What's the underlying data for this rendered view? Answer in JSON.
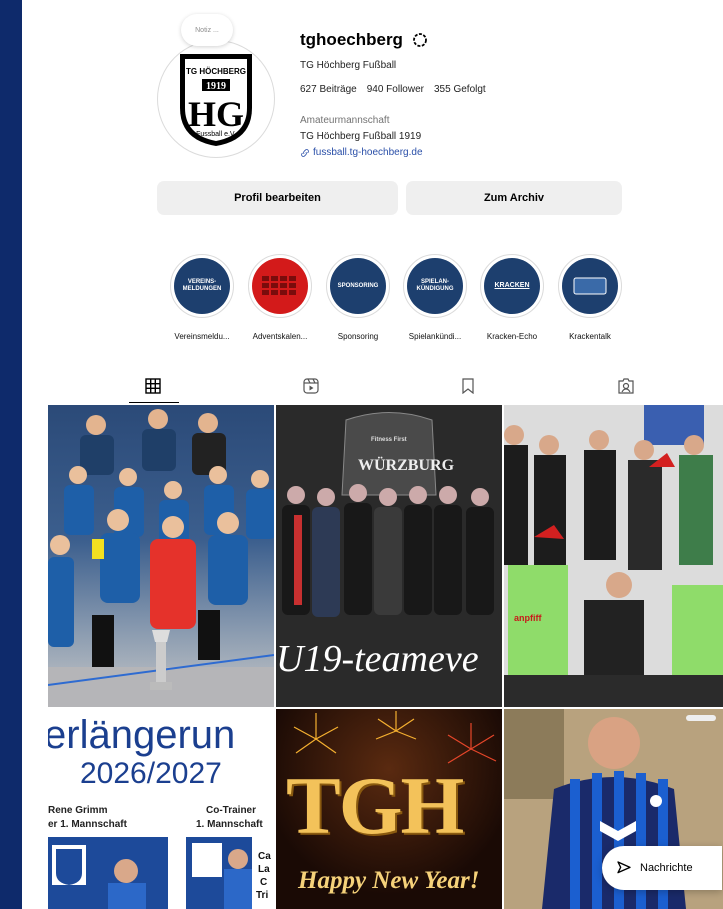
{
  "profile": {
    "note_label": "Notiz ...",
    "username": "tghoechberg",
    "full_name": "TG Höchberg Fußball",
    "stats": {
      "posts": "627 Beiträge",
      "followers": "940 Follower",
      "following": "355 Gefolgt"
    },
    "category": "Amateurmannschaft",
    "bio_line": "TG Höchberg Fußball 1919",
    "website": "fussball.tg-hoechberg.de",
    "logo": {
      "top": "TG HÖCHBERG",
      "year": "1919",
      "bottom": "Fussball e.V."
    }
  },
  "buttons": {
    "edit_profile": "Profil bearbeiten",
    "archive": "Zum Archiv"
  },
  "highlights": [
    {
      "label": "Vereinsmeldu...",
      "cover_text": "VEREINS-\nMELDUNGEN",
      "color": "#1d3f6e"
    },
    {
      "label": "Adventskalen...",
      "cover_text": "",
      "color": "#d31a1a"
    },
    {
      "label": "Sponsoring",
      "cover_text": "SPONSORING",
      "color": "#1d3f6e"
    },
    {
      "label": "Spielankündi...",
      "cover_text": "SPIELAN-\nKÜNDIGUNG",
      "color": "#1d3f6e"
    },
    {
      "label": "Kracken-Echo",
      "cover_text": "KRACKEN",
      "color": "#1d3f6e"
    },
    {
      "label": "Krackentalk",
      "cover_text": "",
      "color": "#1d3f6e"
    }
  ],
  "tabs": [
    "grid-icon",
    "reels-icon",
    "saved-icon",
    "tagged-icon"
  ],
  "posts": {
    "post2_banner": "WÜRZBURG",
    "post2_brand": "Fitness First",
    "post2_caption": "U19-teameve",
    "post3_shirt": "anpfiff",
    "post4_title": "erlängerun",
    "post4_season": "2026/2027",
    "post4_name_left": "Rene Grimm",
    "post4_role_left": "er 1. Mannschaft",
    "post4_name_right": "Co-Trainer",
    "post4_role_right": "1. Mannschaft",
    "post4_fragments": [
      "Ca",
      "La",
      "C",
      "Tri"
    ],
    "post5_big": "TGH",
    "post5_script": "Happy New Year!"
  },
  "message_button": "Nachrichte"
}
